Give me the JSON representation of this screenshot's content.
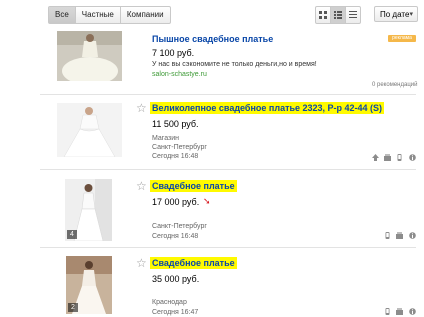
{
  "filters": {
    "tabs": [
      "Все",
      "Частные",
      "Компании"
    ],
    "active": "Все"
  },
  "sort": {
    "label": "По дате",
    "arrow": "▾"
  },
  "ad": {
    "label": "реклама",
    "title": "Пышное свадебное платье",
    "price": "7 100 руб.",
    "text": "У нас вы сэкономите не только деньги,но и время!",
    "site": "salon-schastye.ru",
    "recommend": "0 рекомендаций"
  },
  "listings": [
    {
      "title": "Великолепное свадебное платье 2323, Р-р 42-44 (S)",
      "price": "11 500 руб.",
      "seller": "Магазин",
      "city": "Санкт-Петербург",
      "time": "Сегодня 16:48",
      "photos": ""
    },
    {
      "title": "Свадебное платье",
      "price": "17 000 руб.",
      "seller": "",
      "city": "Санкт-Петербург",
      "time": "Сегодня 16:48",
      "photos": "4"
    },
    {
      "title": "Свадебное платье",
      "price": "35 000 руб.",
      "seller": "",
      "city": "Краснодар",
      "time": "Сегодня 16:47",
      "photos": "2"
    }
  ]
}
